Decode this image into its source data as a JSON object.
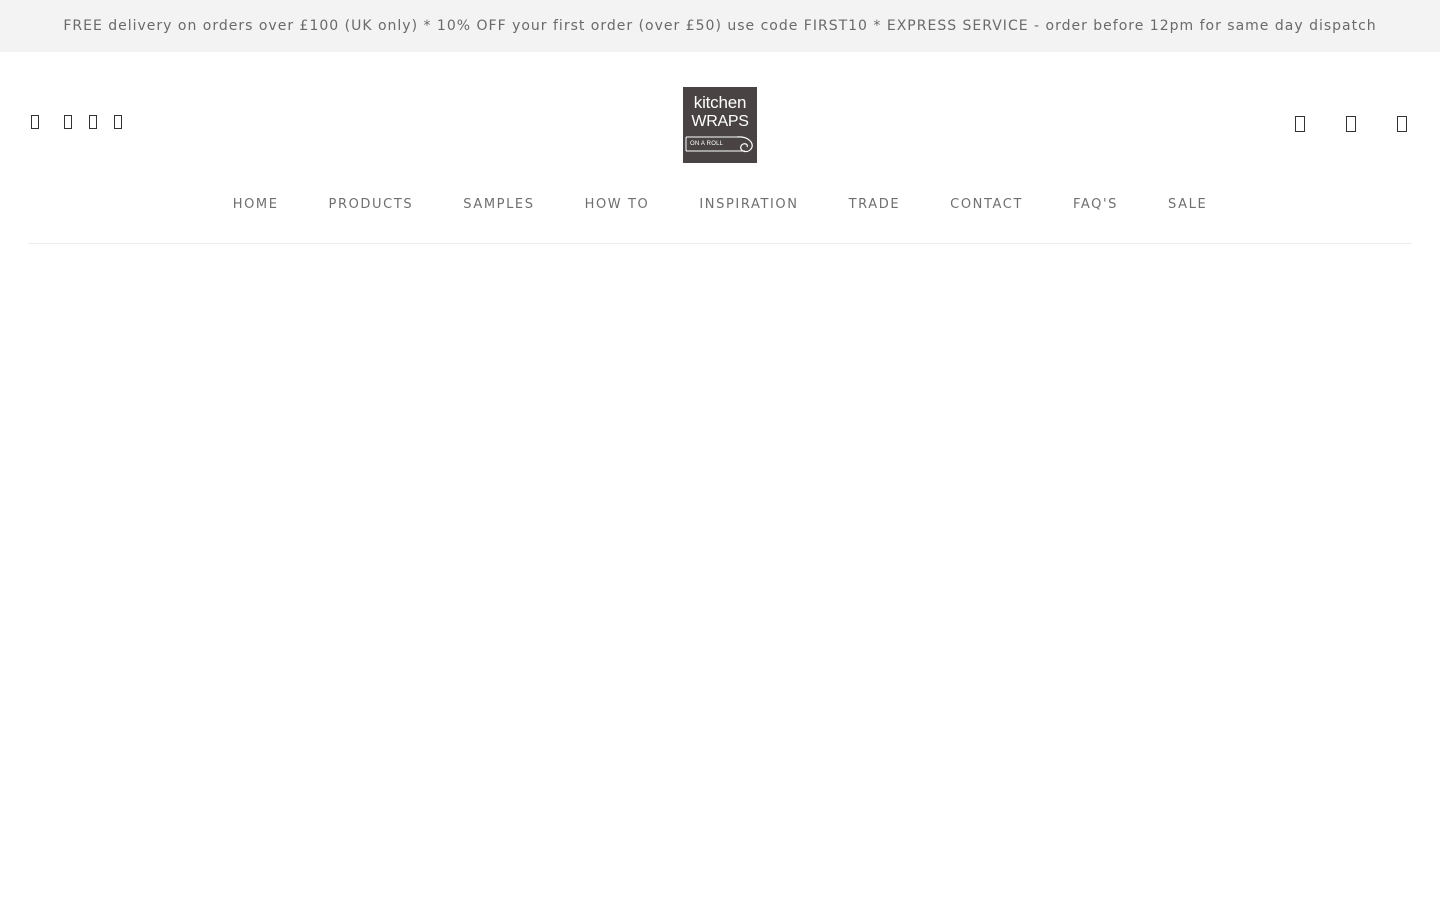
{
  "announcement": {
    "text": "FREE delivery on orders over £100 (UK only) * 10% OFF your first order (over £50) use code FIRST10 * EXPRESS SERVICE - order before 12pm for same day dispatch"
  },
  "header": {
    "social_icons": [
      "facebook-icon",
      "instagram-icon",
      "pinterest-icon",
      "youtube-icon"
    ],
    "logo": {
      "line1": "kitchen",
      "line2": "WRAPS",
      "line3": "ON A ROLL",
      "background": "#4a4344"
    },
    "utility_icons": [
      "search-icon",
      "account-icon",
      "cart-icon"
    ]
  },
  "nav": {
    "items": [
      "HOME",
      "PRODUCTS",
      "SAMPLES",
      "HOW TO",
      "INSPIRATION",
      "TRADE",
      "CONTACT",
      "FAQ'S",
      "SALE"
    ]
  },
  "colors": {
    "announcement_bg": "#f3f3f3",
    "announcement_text": "#6a6a6a",
    "nav_text": "#6f6f6f",
    "logo_bg": "#4a4344",
    "divider": "#ececec"
  }
}
